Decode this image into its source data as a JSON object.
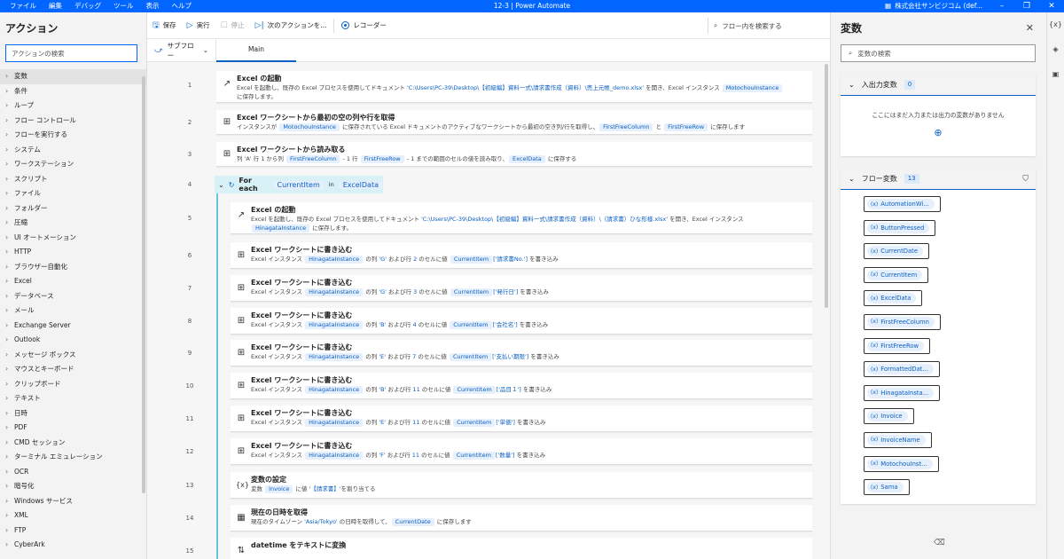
{
  "titlebar": {
    "menus": [
      "ファイル",
      "編集",
      "デバッグ",
      "ツール",
      "表示",
      "ヘルプ"
    ],
    "title": "12-3 | Power Automate",
    "account": "株式会社サンビジコム (def..."
  },
  "actions_pane": {
    "title": "アクション",
    "search_placeholder": "アクションの検索",
    "categories": [
      "変数",
      "条件",
      "ループ",
      "フロー コントロール",
      "フローを実行する",
      "システム",
      "ワークステーション",
      "スクリプト",
      "ファイル",
      "フォルダー",
      "圧縮",
      "UI オートメーション",
      "HTTP",
      "ブラウザー自動化",
      "Excel",
      "データベース",
      "メール",
      "Exchange Server",
      "Outlook",
      "メッセージ ボックス",
      "マウスとキーボード",
      "クリップボード",
      "テキスト",
      "日時",
      "PDF",
      "CMD セッション",
      "ターミナル エミュレーション",
      "OCR",
      "暗号化",
      "Windows サービス",
      "XML",
      "FTP",
      "CyberArk"
    ]
  },
  "toolbar": {
    "save": "保存",
    "run": "実行",
    "stop": "停止",
    "next": "次のアクションを...",
    "recorder": "レコーダー",
    "flow_search": "フロー内を検索する"
  },
  "tabs": {
    "subflow": "サブフロー",
    "main": "Main"
  },
  "steps": {
    "s1": {
      "num": "1",
      "title": "Excel の起動",
      "d1": "Excel を起動し、既存の Excel プロセスを使用してドキュメント ",
      "path": "'C:\\Users\\PC-39\\Desktop\\【初級編】資料一式\\請求書作成（資料）\\売上元帳_demo.xlsx'",
      "d2": " を開き、Excel インスタンス ",
      "var": "MotochouInstance",
      "d3": "に保存します。"
    },
    "s2": {
      "num": "2",
      "title": "Excel ワークシートから最初の空の列や行を取得",
      "d1": "インスタンスが ",
      "v1": "MotochouInstance",
      "d2": " に保存されている Excel ドキュメントのアクティブなワークシートから最初の空き列/行を取得し、",
      "v2": "FirstFreeColumn",
      "d3": " と ",
      "v3": "FirstFreeRow",
      "d4": " に保存します"
    },
    "s3": {
      "num": "3",
      "title": "Excel ワークシートから読み取る",
      "d1": "列 'A' 行 1 から列 ",
      "v1": "FirstFreeColumn",
      "d2": " - 1 行 ",
      "v2": "FirstFreeRow",
      "d3": " - 1 までの範囲のセルの値を読み取り、",
      "v3": "ExcelData",
      "d4": " に保存する"
    },
    "s4": {
      "num": "4",
      "title": "For each",
      "v1": "CurrentItem",
      "in": "in",
      "v2": "ExcelData"
    },
    "s5": {
      "num": "5",
      "title": "Excel の起動",
      "d1": "Excel を起動し、既存の Excel プロセスを使用してドキュメント ",
      "path": "'C:\\Users\\PC-39\\Desktop\\【初級編】資料一式\\請求書作成（資料）\\（請求書）ひな形様.xlsx'",
      "d2": " を開き、Excel インスタンス",
      "var": "HinagataInstance",
      "d3": " に保存します。"
    },
    "writes": [
      {
        "num": "6",
        "col": "'G'",
        "row": "2",
        "field": "['請求書No.']"
      },
      {
        "num": "7",
        "col": "'G'",
        "row": "3",
        "field": "['発行日']"
      },
      {
        "num": "8",
        "col": "'B'",
        "row": "4",
        "field": "['会社名']"
      },
      {
        "num": "9",
        "col": "'E'",
        "row": "7",
        "field": "['支払い期限']"
      },
      {
        "num": "10",
        "col": "'B'",
        "row": "11",
        "field": "['品目１']"
      },
      {
        "num": "11",
        "col": "'E'",
        "row": "11",
        "field": "['単価']"
      },
      {
        "num": "12",
        "col": "'F'",
        "row": "11",
        "field": "['数量']"
      }
    ],
    "write_title": "Excel ワークシートに書き込む",
    "write_d1": "Excel インスタンス ",
    "write_inst": "HinagataInstance",
    "write_d2": " の列 ",
    "write_d3": " および行 ",
    "write_d4": " のセルに値 ",
    "write_item": "CurrentItem",
    "write_d5": " を書き込み",
    "s13": {
      "num": "13",
      "title": "変数の設定",
      "d1": "変数 ",
      "v1": "Invoice",
      "d2": " に値 ",
      "str": "'【請求書】'",
      "d3": "を割り当てる"
    },
    "s14": {
      "num": "14",
      "title": "現在の日時を取得",
      "d1": "現在のタイムゾーン ",
      "str": "'Asia/Tokyo'",
      "d2": " の日時を取得して、",
      "v1": "CurrentDate",
      "d3": " に保存します"
    },
    "s15": {
      "num": "15",
      "title": "datetime をテキストに変換"
    }
  },
  "variables_pane": {
    "title": "変数",
    "search_placeholder": "変数の検索",
    "io_title": "入出力変数",
    "io_count": "0",
    "io_empty": "ここにはまだ入力または出力の変数がありません",
    "flow_title": "フロー変数",
    "flow_count": "13",
    "flow_vars": [
      "AutomationWi...",
      "ButtonPressed",
      "CurrentDate",
      "CurrentItem",
      "ExcelData",
      "FirstFreeColumn",
      "FirstFreeRow",
      "FormattedDat...",
      "HinagataInsta...",
      "Invoice",
      "InvoiceName",
      "MotochouInst...",
      "Sama"
    ]
  }
}
